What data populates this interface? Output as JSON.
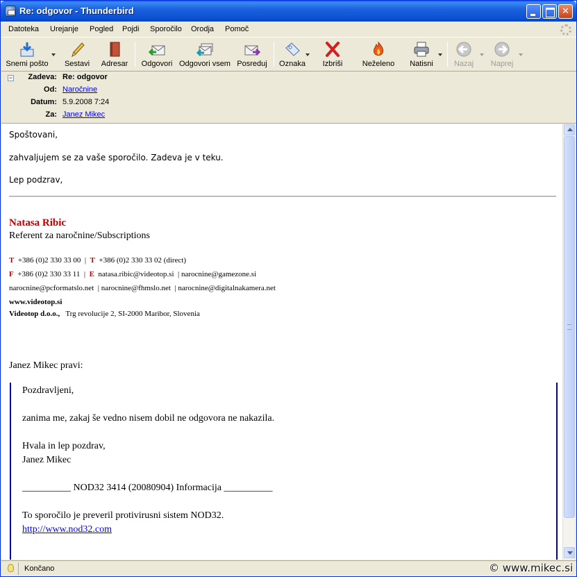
{
  "window": {
    "title": "Re: odgovor - Thunderbird"
  },
  "menu": [
    "Datoteka",
    "Urejanje",
    "Pogled",
    "Pojdi",
    "Sporočilo",
    "Orodja",
    "Pomoč"
  ],
  "toolbar": {
    "get_mail": "Snemi pošto",
    "compose": "Sestavi",
    "address_book": "Adresar",
    "reply": "Odgovori",
    "reply_all": "Odgovori vsem",
    "forward": "Posreduj",
    "tag": "Oznaka",
    "delete": "Izbriši",
    "junk": "Neželeno",
    "print": "Natisni",
    "back": "Nazaj",
    "forward_nav": "Naprej"
  },
  "header": {
    "subject_label": "Zadeva:",
    "subject": "Re: odgovor",
    "from_label": "Od:",
    "from": "Naročnine",
    "date_label": "Datum:",
    "date": "5.9.2008 7:24",
    "to_label": "Za:",
    "to": "Janez Mikec"
  },
  "message": {
    "greeting": "Spoštovani,",
    "line1": "zahvaljujem se za vaše sporočilo. Zadeva je v teku.",
    "closing": "Lep podzrav,",
    "signature": {
      "name": "Natasa Ribic",
      "role": "Referent za naročnine/Subscriptions",
      "t_letter": "T",
      "phone1": "+386 (0)2 330 33 00",
      "phone2": "+386 (0)2 330 33 02 (direct)",
      "f_letter": "F",
      "fax": "+386 (0)2 330 33 11",
      "e_letter": "E",
      "email1": "natasa.ribic@videotop.si",
      "email2": "narocnine@gamezone.si",
      "email3": "narocnine@pcformatslo.net",
      "email4": "narocnine@fhmslo.net",
      "email5": "narocnine@digitalnakamera.net",
      "website": "www.videotop.si",
      "company": "Videotop d.o.o.,",
      "address": "Trg revolucije 2, SI-2000 Maribor, Slovenia"
    },
    "quote_intro": "Janez Mikec pravi:",
    "quote": {
      "greeting": "Pozdravljeni,",
      "line1": "zanima me, zakaj še vedno nisem dobil ne odgovora ne nakazila.",
      "closing1": "Hvala in lep pozdrav,",
      "closing2": "Janez Mikec",
      "nod_line": "__________ NOD32 3414 (20080904) Informacija __________",
      "av_line": "To sporočilo je preveril protivirusni sistem NOD32.",
      "link": "http://www.nod32.com"
    }
  },
  "status": {
    "text": "Končano",
    "watermark": "© www.mikec.si"
  }
}
